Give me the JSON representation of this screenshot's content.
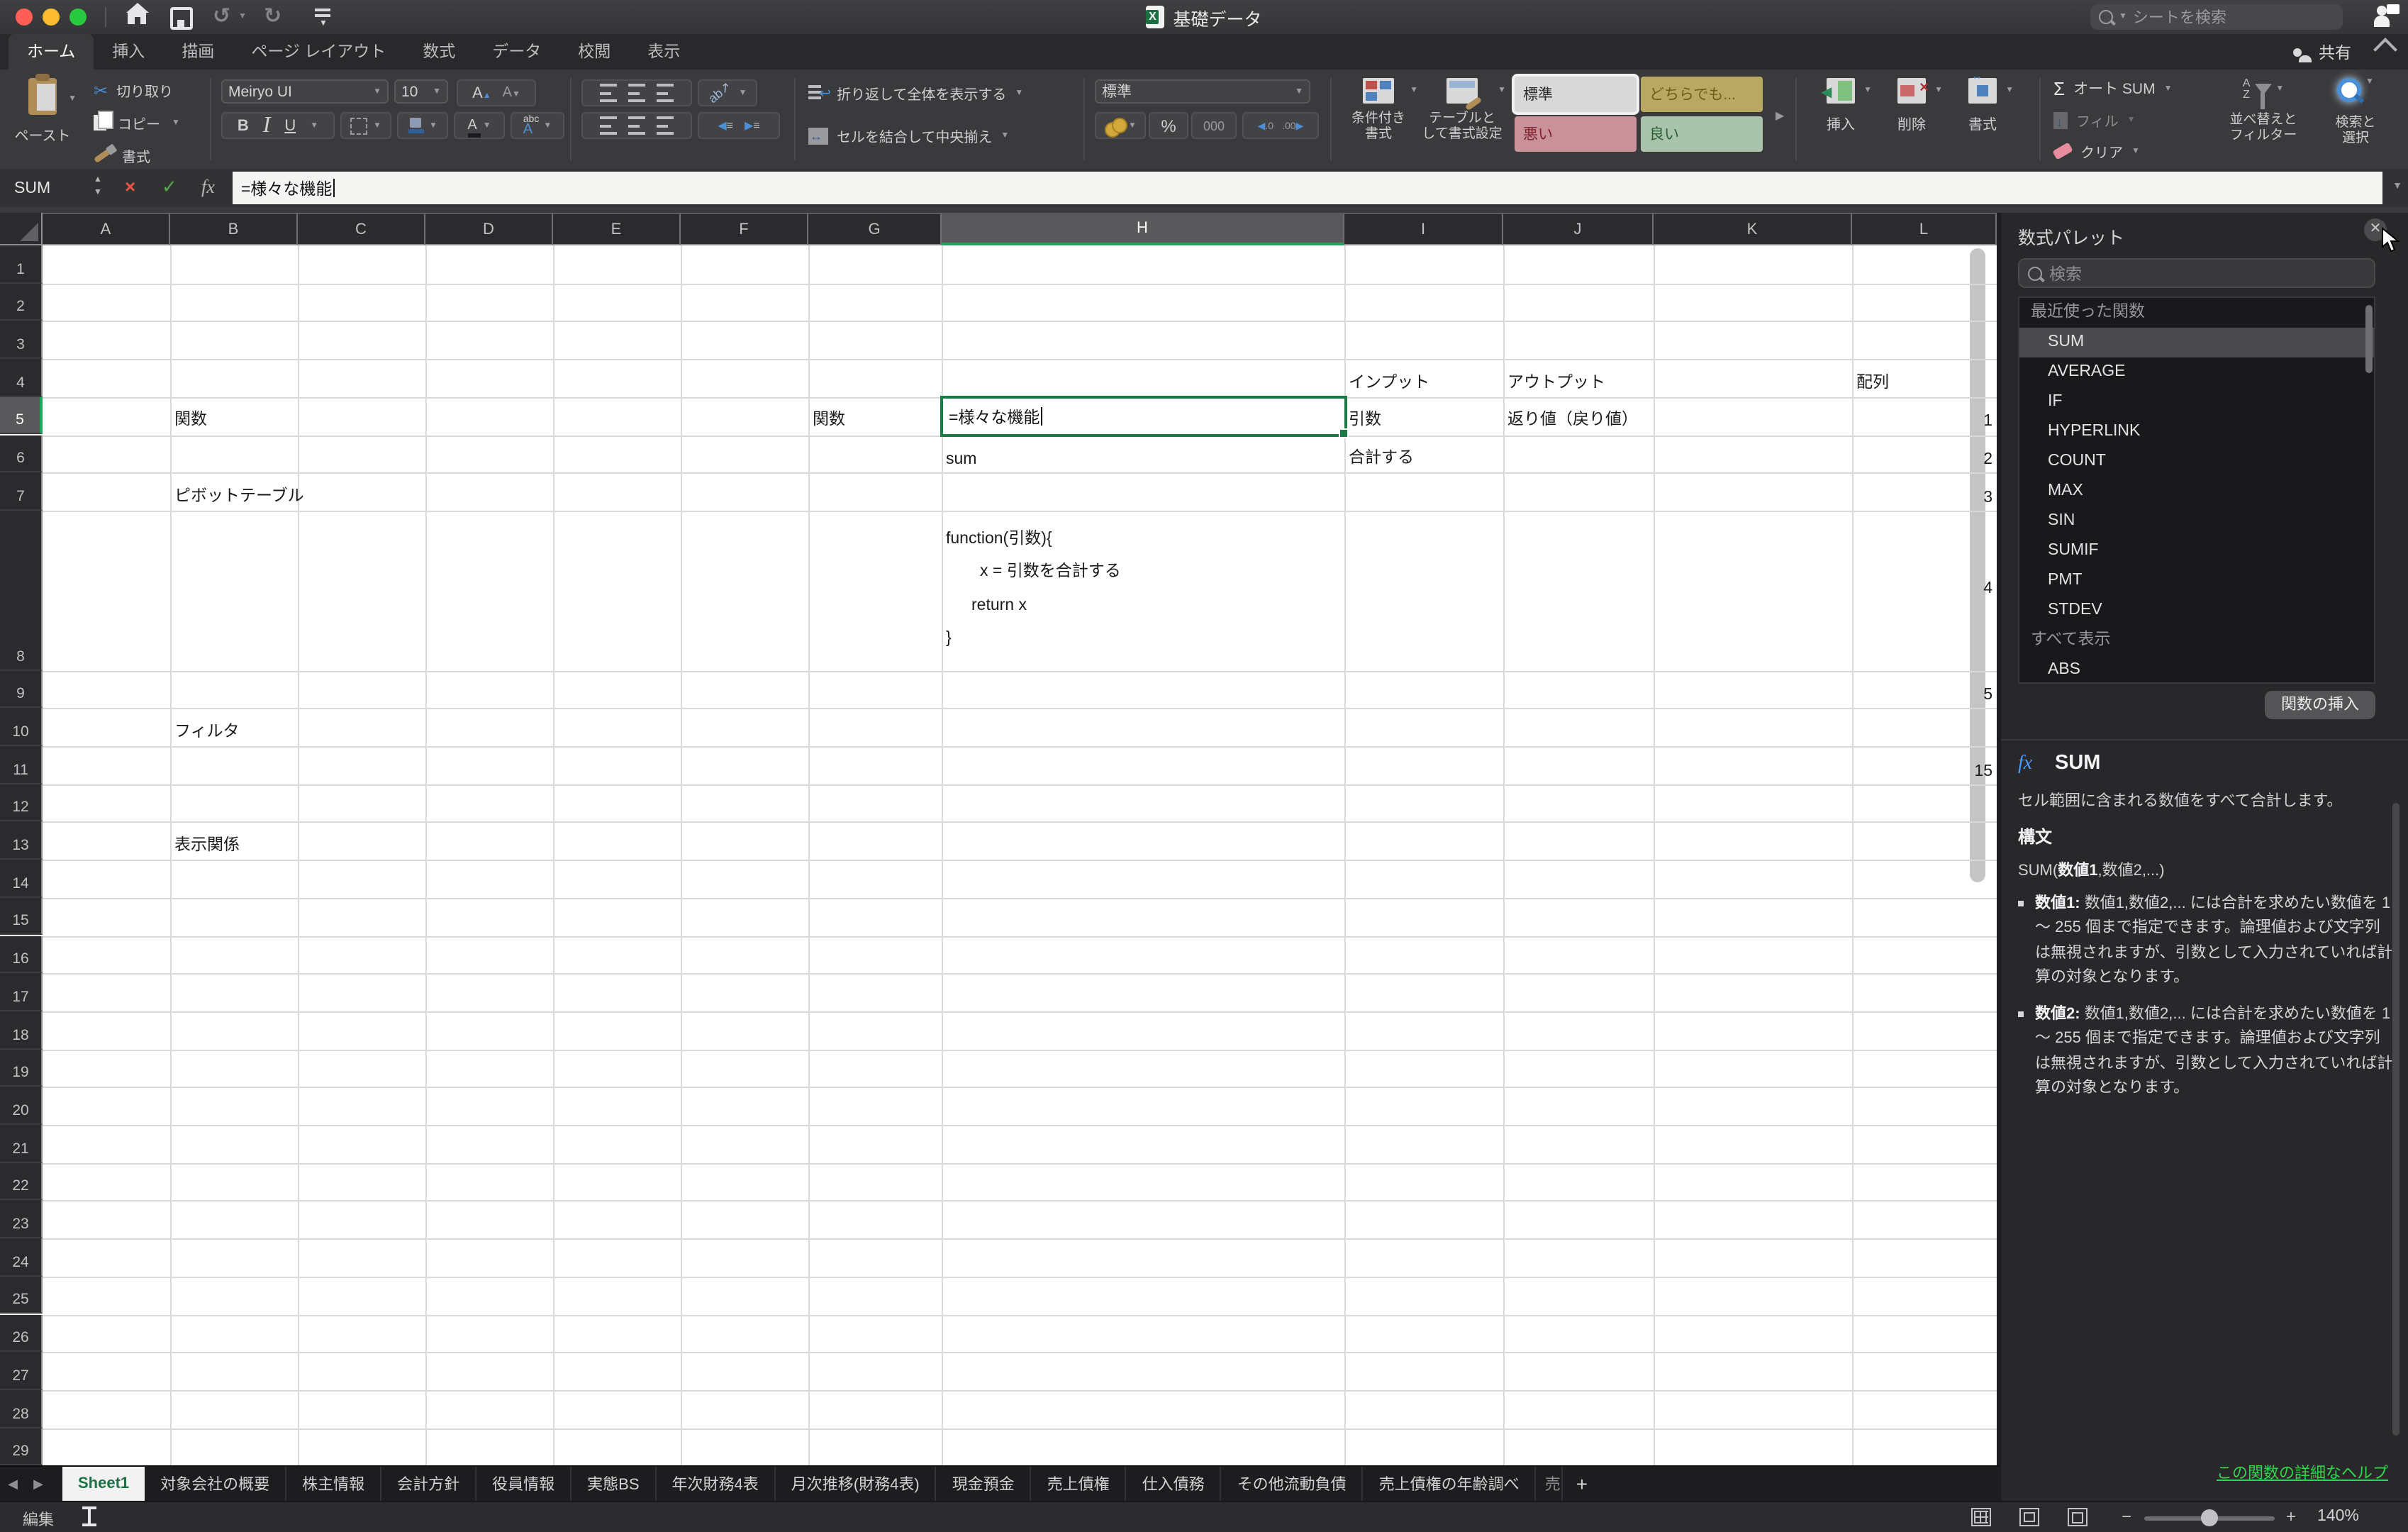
{
  "colors": {
    "excel_green": "#217346",
    "selection_green": "#1a7b44",
    "link_green": "#32d74b",
    "traffic_red": "#ff5f57",
    "traffic_yellow": "#febc2e",
    "traffic_green": "#28c840",
    "style_neutral_bg": "#b9a863",
    "style_bad_bg": "#c9929a",
    "style_good_bg": "#a9c4ab"
  },
  "titlebar": {
    "title": "基礎データ",
    "search_placeholder": "シートを検索"
  },
  "ribbon_tabs": [
    {
      "label": "ホーム",
      "active": true
    },
    {
      "label": "挿入",
      "active": false
    },
    {
      "label": "描画",
      "active": false
    },
    {
      "label": "ページ レイアウト",
      "active": false
    },
    {
      "label": "数式",
      "active": false
    },
    {
      "label": "データ",
      "active": false
    },
    {
      "label": "校閲",
      "active": false
    },
    {
      "label": "表示",
      "active": false
    }
  ],
  "share_label": "共有",
  "ribbon": {
    "paste": "ペースト",
    "cut": "切り取り",
    "copy": "コピー",
    "format_painter": "書式",
    "font_name": "Meiryo UI",
    "font_size": "10",
    "bold": "B",
    "italic": "I",
    "underline": "U",
    "wrap_text": "折り返して全体を表示する",
    "merge_center": "セルを結合して中央揃え",
    "number_format": "標準",
    "num_percent": "%",
    "num_000": "000",
    "dec_left": ".0 .00",
    "dec_right": ".00 .0",
    "cond_line1": "条件付き",
    "cond_line2": "書式",
    "table_line1": "テーブルと",
    "table_line2": "して書式設定",
    "styles": [
      "標準",
      "どちらでも...",
      "悪い",
      "良い"
    ],
    "insert": "挿入",
    "delete": "削除",
    "format_cells": "書式",
    "autosum": "オート SUM",
    "fill": "フィル",
    "clear": "クリア",
    "sort_line1": "並べ替えと",
    "sort_line2": "フィルター",
    "find_line1": "検索と",
    "find_line2": "選択"
  },
  "formula_bar": {
    "name_box": "SUM",
    "formula": "=様々な機能"
  },
  "sheet": {
    "columns": [
      "A",
      "B",
      "C",
      "D",
      "E",
      "F",
      "G",
      "H",
      "I",
      "J",
      "K",
      "L"
    ],
    "row_count": 29,
    "active_column": "H",
    "active_row": 5,
    "cells": [
      {
        "col": "B",
        "row": 5,
        "text": "関数"
      },
      {
        "col": "G",
        "row": 5,
        "text": "関数"
      },
      {
        "col": "B",
        "row": 7,
        "text": "ピボットテーブル"
      },
      {
        "col": "B",
        "row": 10,
        "text": "フィルタ"
      },
      {
        "col": "B",
        "row": 13,
        "text": "表示関係"
      },
      {
        "col": "H",
        "row": 6,
        "text": "sum"
      },
      {
        "col": "I",
        "row": 4,
        "text": "インプット"
      },
      {
        "col": "I",
        "row": 5,
        "text": "引数"
      },
      {
        "col": "I",
        "row": 6,
        "text": "合計する"
      },
      {
        "col": "J",
        "row": 4,
        "text": "アウトプット"
      },
      {
        "col": "J",
        "row": 5,
        "text": "返り値（戻り値）"
      },
      {
        "col": "L",
        "row": 4,
        "text": "配列"
      },
      {
        "col": "L",
        "row": 5,
        "text": "1",
        "halign": "right"
      },
      {
        "col": "L",
        "row": 6,
        "text": "2",
        "halign": "right"
      },
      {
        "col": "L",
        "row": 7,
        "text": "3",
        "halign": "right"
      },
      {
        "col": "L",
        "row": 8,
        "text": "4",
        "halign": "right",
        "valign": "middle"
      },
      {
        "col": "L",
        "row": 9,
        "text": "5",
        "halign": "right"
      },
      {
        "col": "L",
        "row": 11,
        "text": "15",
        "halign": "right"
      }
    ],
    "code_cell": {
      "col": "H",
      "row": 8,
      "lines": [
        {
          "text": "function(引数){",
          "indent": 0
        },
        {
          "text": "x = 引数を合計する",
          "indent": 24
        },
        {
          "text": "return x",
          "indent": 18
        },
        {
          "text": "}",
          "indent": 0
        }
      ]
    },
    "selection": {
      "col": "H",
      "row": 5,
      "text": "=様々な機能"
    }
  },
  "panel": {
    "title": "数式パレット",
    "search_placeholder": "検索",
    "recent_label": "最近使った関数",
    "recent_functions": [
      "SUM",
      "AVERAGE",
      "IF",
      "HYPERLINK",
      "COUNT",
      "MAX",
      "SIN",
      "SUMIF",
      "PMT",
      "STDEV"
    ],
    "selected_function": "SUM",
    "all_label": "すべて表示",
    "all_functions": [
      "ABS"
    ],
    "insert_button": "関数の挿入",
    "detail": {
      "fx": "fx",
      "name": "SUM",
      "description": "セル範囲に含まれる数値をすべて合計します。",
      "syntax_label": "構文",
      "syntax_prefix": "SUM(",
      "syntax_bold": "数値1",
      "syntax_suffix": ",数値2,...)",
      "args": [
        {
          "name": "数値1:",
          "text": "数値1,数値2,... には合計を求めたい数値を 1 ～ 255 個まで指定できます。論理値および文字列は無視されますが、引数として入力されていれば計算の対象となります。"
        },
        {
          "name": "数値2:",
          "text": "数値1,数値2,... には合計を求めたい数値を 1 ～ 255 個まで指定できます。論理値および文字列は無視されますが、引数として入力されていれば計算の対象となります。"
        }
      ]
    },
    "help_link": "この関数の詳細なヘルプ"
  },
  "sheet_tabs": {
    "active": "Sheet1",
    "items": [
      "Sheet1",
      "対象会社の概要",
      "株主情報",
      "会計方針",
      "役員情報",
      "実態BS",
      "年次財務4表",
      "月次推移(財務4表)",
      "現金預金",
      "売上債権",
      "仕入債務",
      "その他流動負債",
      "売上債権の年齢調べ"
    ],
    "partial": "売",
    "add": "+"
  },
  "status": {
    "mode": "編集",
    "zoom": "140%"
  }
}
